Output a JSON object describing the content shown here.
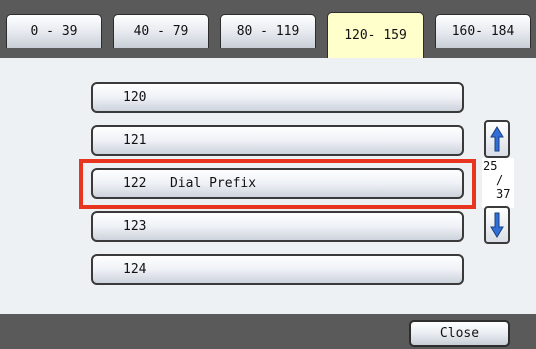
{
  "tabs": [
    {
      "label": "0 - 39",
      "active": false
    },
    {
      "label": "40 - 79",
      "active": false
    },
    {
      "label": "80 - 119",
      "active": false
    },
    {
      "label": "120- 159",
      "active": true
    },
    {
      "label": "160- 184",
      "active": false
    }
  ],
  "rows": [
    {
      "label": "120"
    },
    {
      "label": "121"
    },
    {
      "label": "122   Dial Prefix",
      "highlighted": true
    },
    {
      "label": "123"
    },
    {
      "label": "124"
    }
  ],
  "pager": {
    "current": "25",
    "separator": "/",
    "total": "37"
  },
  "scroll": {
    "up_icon": "arrow-up-icon",
    "down_icon": "arrow-down-icon"
  },
  "footer": {
    "close_label": "Close"
  },
  "colors": {
    "active_tab": "#ffffcc",
    "highlight": "#e8351f",
    "bar": "#5a5a5a",
    "arrow": "#2f6fd6"
  }
}
